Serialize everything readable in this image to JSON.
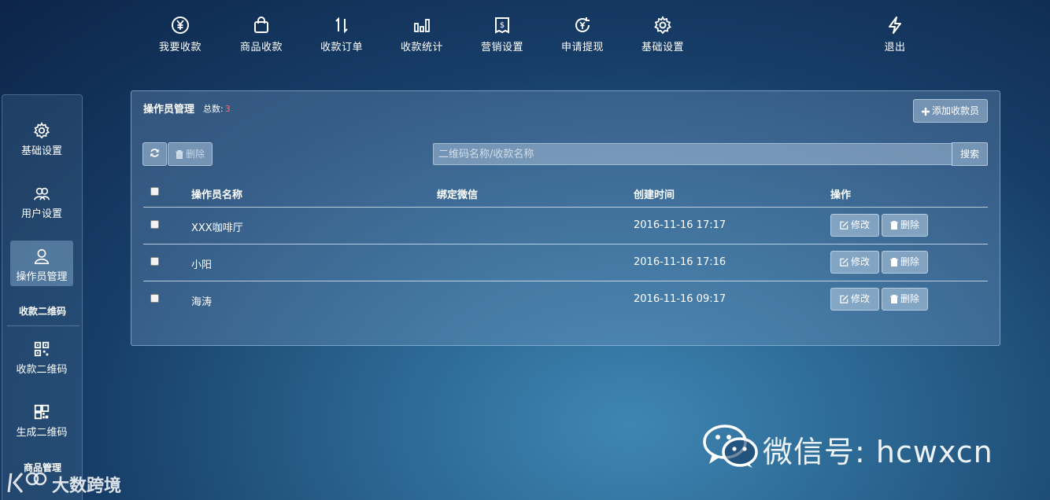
{
  "top_nav": {
    "items": [
      {
        "label": "我要收款",
        "icon": "yen-circle-icon"
      },
      {
        "label": "商品收款",
        "icon": "shopping-bag-icon"
      },
      {
        "label": "收款订单",
        "icon": "up-down-arrows-icon"
      },
      {
        "label": "收款统计",
        "icon": "bar-chart-icon"
      },
      {
        "label": "营销设置",
        "icon": "coupon-icon"
      },
      {
        "label": "申请提现",
        "icon": "yen-refresh-icon"
      },
      {
        "label": "基础设置",
        "icon": "gear-icon"
      }
    ],
    "logout": {
      "label": "退出",
      "icon": "lightning-icon"
    }
  },
  "sidebar": {
    "items": [
      {
        "label": "基础设置",
        "icon": "gear-icon"
      },
      {
        "label": "用户设置",
        "icon": "users-icon"
      },
      {
        "label": "操作员管理",
        "icon": "user-icon",
        "active": true
      }
    ],
    "groups": [
      {
        "title": "收款二维码",
        "items": [
          {
            "label": "收款二维码",
            "icon": "qr-code-icon"
          },
          {
            "label": "生成二维码",
            "icon": "qr-generate-icon"
          }
        ]
      },
      {
        "title": "商品管理",
        "items": []
      }
    ]
  },
  "panel": {
    "title": "操作员管理",
    "total_label": "总数:",
    "total_count": "3",
    "add_button": "添加收款员",
    "delete_button": "删除",
    "search_placeholder": "二维码名称/收款名称",
    "search_button": "搜索",
    "table": {
      "headers": [
        "操作员名称",
        "绑定微信",
        "创建时间",
        "操作"
      ],
      "rows": [
        {
          "name": "XXX咖啡厅",
          "wechat": "",
          "created": "2016-11-16 17:17"
        },
        {
          "name": "小阳",
          "wechat": "",
          "created": "2016-11-16 17:16"
        },
        {
          "name": "海涛",
          "wechat": "",
          "created": "2016-11-16 09:17"
        }
      ],
      "edit_label": "修改",
      "delete_label": "删除"
    }
  },
  "watermarks": {
    "wechat_id": "微信号: hcwxcn",
    "brand": "大数跨境"
  },
  "colors": {
    "total_count": "#ff6b6b",
    "background_dark": "#0c2448",
    "background_light": "#3f86b4"
  }
}
